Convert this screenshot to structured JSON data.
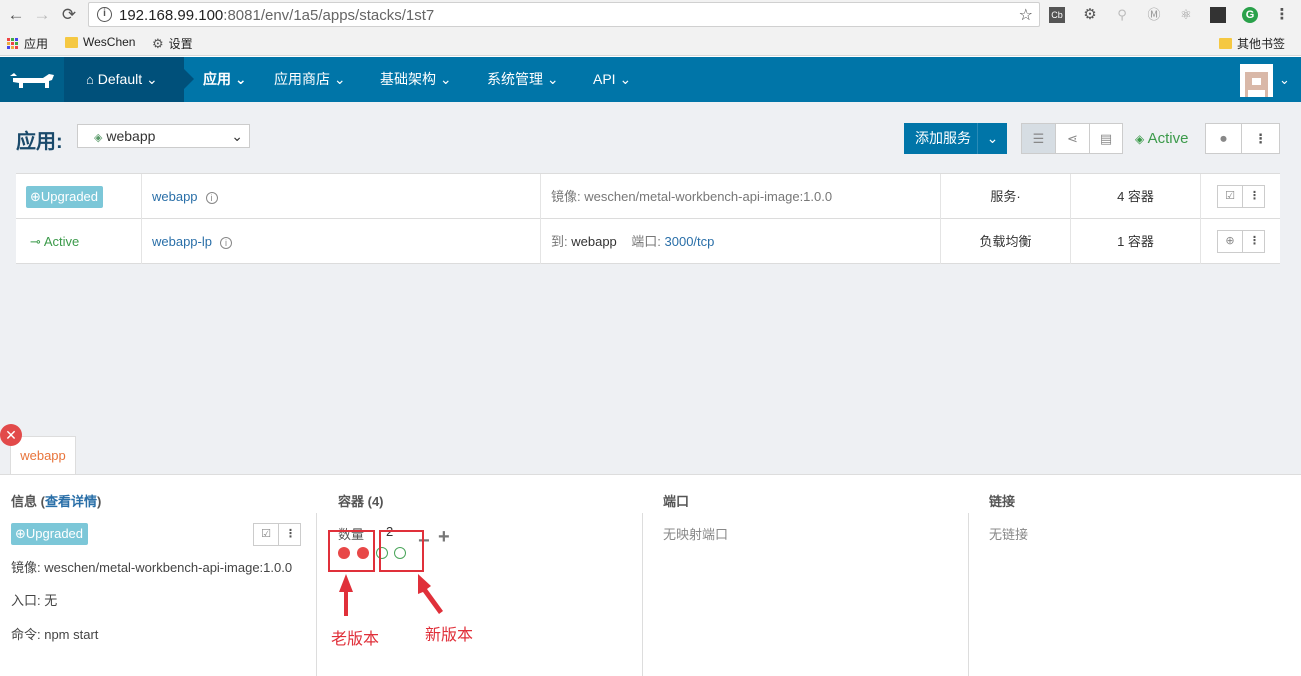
{
  "browser": {
    "url_host": "192.168.99.100",
    "url_rest": ":8081/env/1a5/apps/stacks/1st7",
    "bookmarks": [
      "应用",
      "WesChen",
      "设置"
    ],
    "other_bookmarks": "其他书签"
  },
  "nav": {
    "environment": "Default",
    "items": [
      "应用",
      "应用商店",
      "基础架构",
      "系统管理",
      "API"
    ]
  },
  "header": {
    "title": "应用:",
    "stack_select": "webapp",
    "add_service": "添加服务",
    "stack_state": "Active"
  },
  "services": [
    {
      "state": "Upgraded",
      "name": "webapp",
      "detail_label": "镜像:",
      "detail_value": "weschen/metal-workbench-api-image:1.0.0",
      "kind": "服务·",
      "containers": "4 容器"
    },
    {
      "state": "Active",
      "name": "webapp-lp",
      "detail_label": "到:",
      "detail_value": "webapp",
      "port_label": "端口:",
      "port_value": "3000/tcp",
      "kind": "负载均衡",
      "containers": "1 容器"
    }
  ],
  "panel": {
    "tab": "webapp",
    "info_title": "信息 (",
    "info_link": "查看详情",
    "info_title_end": ")",
    "state": "Upgraded",
    "image": "镜像: weschen/metal-workbench-api-image:1.0.0",
    "entry": "入口: 无",
    "command": "命令: npm start",
    "containers_title": "容器 (4)",
    "qty_label": "数量",
    "qty_value": "2",
    "ports_title": "端口",
    "ports_empty": "无映射端口",
    "links_title": "链接",
    "links_empty": "无链接"
  },
  "annotations": {
    "old": "老版本",
    "new": "新版本"
  },
  "colors": {
    "brand": "#0075a8",
    "active": "#3b9a4a",
    "upgraded": "#7cc7d8",
    "annotation": "#e0303a"
  }
}
